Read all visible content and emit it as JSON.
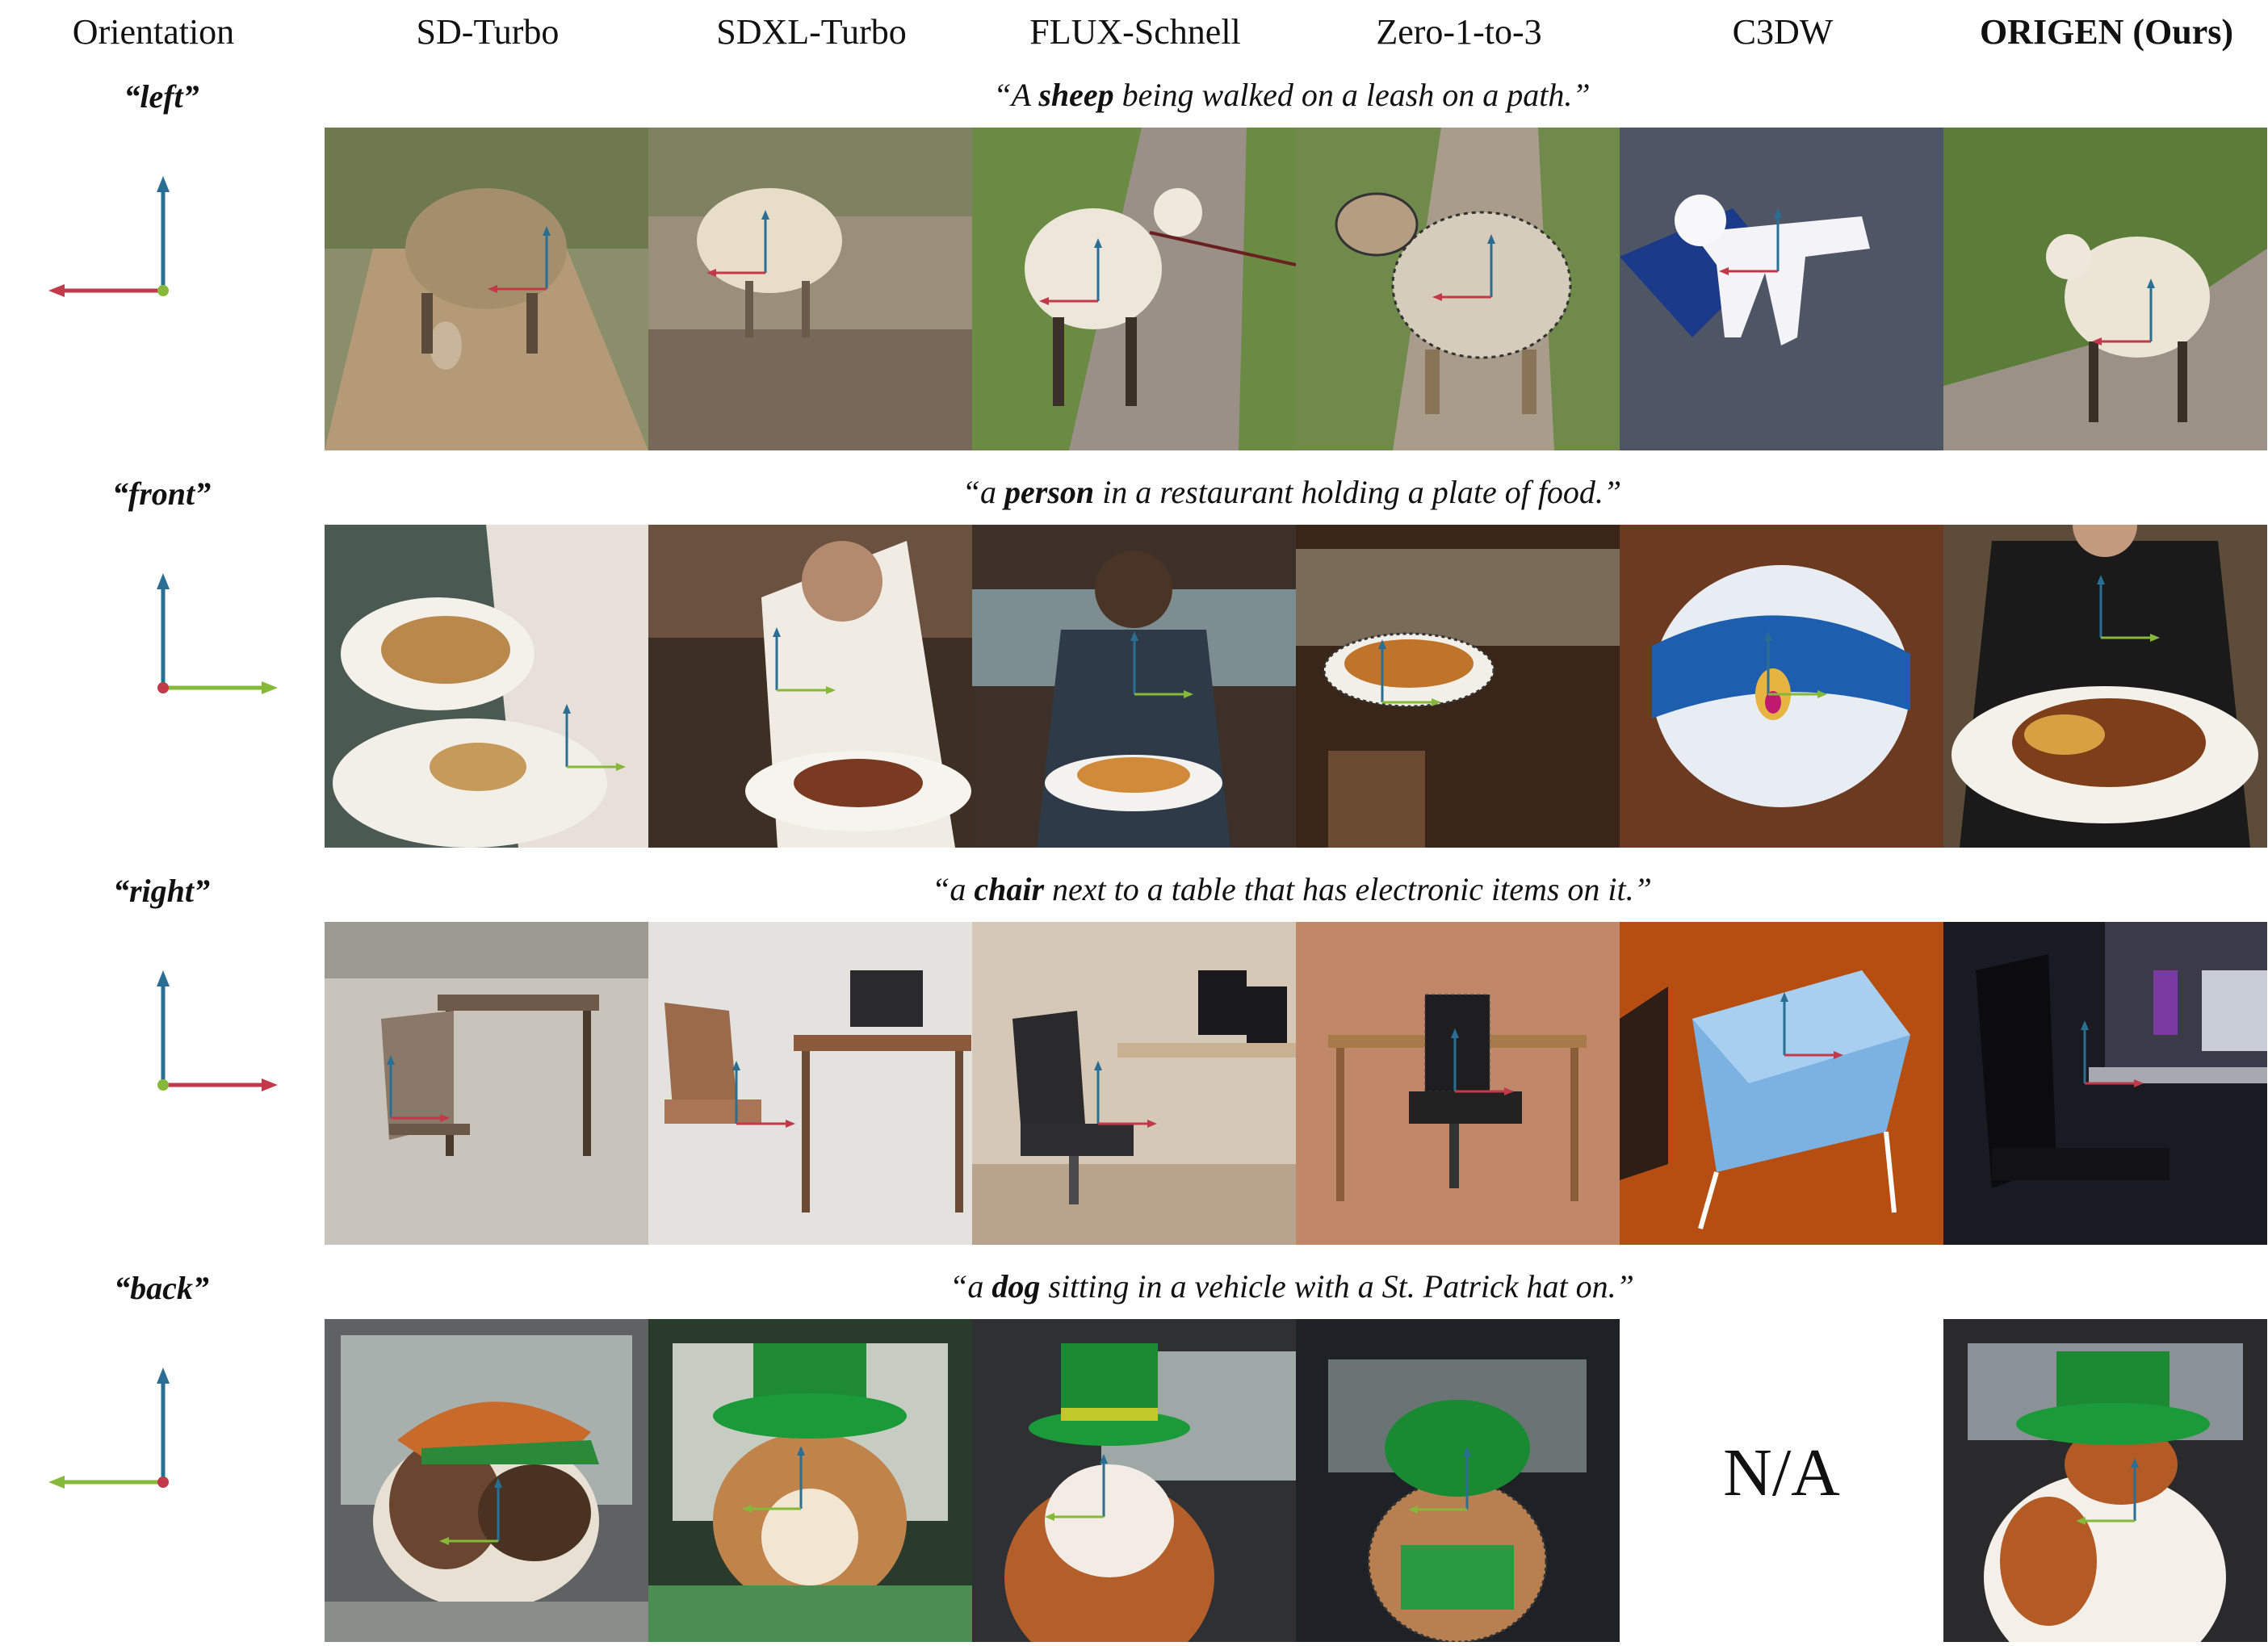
{
  "columns": {
    "orientation": "Orientation",
    "methods": [
      "SD-Turbo",
      "SDXL-Turbo",
      "FLUX-Schnell",
      "Zero-1-to-3",
      "C3DW",
      "ORIGEN (Ours)"
    ]
  },
  "rows": [
    {
      "orientation": "“left”",
      "caption": {
        "pre": "“A ",
        "obj": "sheep",
        "post": " being walked on a leash on a path.”"
      },
      "images": [
        "sheep on dirt path",
        "sheep on leash",
        "sheep walking on path",
        "sheep cut-out",
        "white 3D animal model",
        "sheep on grass path"
      ]
    },
    {
      "orientation": "“front”",
      "caption": {
        "pre": "“a ",
        "obj": "person",
        "post": "  in a restaurant holding a plate  of food.”"
      },
      "images": [
        "hands holding plates",
        "person pointing at plate",
        "man holding plate",
        "plate of food cut-out",
        "3D plate model",
        "person holding plate"
      ]
    },
    {
      "orientation": "“right”",
      "caption": {
        "pre": "“a ",
        "obj": "chair",
        "post": " next to a table that has electronic items on it.”"
      },
      "images": [
        "chair by table",
        "chair by desk",
        "office chair at desk",
        "office chair cut-out",
        "3D chair model",
        "office chair"
      ]
    },
    {
      "orientation": "“back”",
      "caption": {
        "pre": "“a ",
        "obj": "dog",
        "post": " sitting in a vehicle with a St. Patrick hat on.”"
      },
      "images": [
        "dog in car window",
        "dog in green hat",
        "dog in car",
        "dog cut-out in car",
        "N/A",
        "dog in green hat"
      ]
    }
  ],
  "na_label": "N/A",
  "colors": {
    "up_axis": "#2a6f93",
    "red_axis": "#c23a4a",
    "green_axis": "#86b83a"
  }
}
